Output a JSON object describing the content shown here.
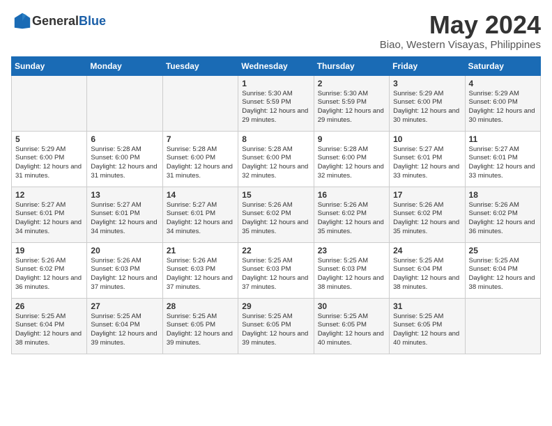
{
  "logo": {
    "general": "General",
    "blue": "Blue"
  },
  "title": "May 2024",
  "location": "Biao, Western Visayas, Philippines",
  "days_header": [
    "Sunday",
    "Monday",
    "Tuesday",
    "Wednesday",
    "Thursday",
    "Friday",
    "Saturday"
  ],
  "weeks": [
    [
      {
        "day": "",
        "info": ""
      },
      {
        "day": "",
        "info": ""
      },
      {
        "day": "",
        "info": ""
      },
      {
        "day": "1",
        "info": "Sunrise: 5:30 AM\nSunset: 5:59 PM\nDaylight: 12 hours\nand 29 minutes."
      },
      {
        "day": "2",
        "info": "Sunrise: 5:30 AM\nSunset: 5:59 PM\nDaylight: 12 hours\nand 29 minutes."
      },
      {
        "day": "3",
        "info": "Sunrise: 5:29 AM\nSunset: 6:00 PM\nDaylight: 12 hours\nand 30 minutes."
      },
      {
        "day": "4",
        "info": "Sunrise: 5:29 AM\nSunset: 6:00 PM\nDaylight: 12 hours\nand 30 minutes."
      }
    ],
    [
      {
        "day": "5",
        "info": "Sunrise: 5:29 AM\nSunset: 6:00 PM\nDaylight: 12 hours\nand 31 minutes."
      },
      {
        "day": "6",
        "info": "Sunrise: 5:28 AM\nSunset: 6:00 PM\nDaylight: 12 hours\nand 31 minutes."
      },
      {
        "day": "7",
        "info": "Sunrise: 5:28 AM\nSunset: 6:00 PM\nDaylight: 12 hours\nand 31 minutes."
      },
      {
        "day": "8",
        "info": "Sunrise: 5:28 AM\nSunset: 6:00 PM\nDaylight: 12 hours\nand 32 minutes."
      },
      {
        "day": "9",
        "info": "Sunrise: 5:28 AM\nSunset: 6:00 PM\nDaylight: 12 hours\nand 32 minutes."
      },
      {
        "day": "10",
        "info": "Sunrise: 5:27 AM\nSunset: 6:01 PM\nDaylight: 12 hours\nand 33 minutes."
      },
      {
        "day": "11",
        "info": "Sunrise: 5:27 AM\nSunset: 6:01 PM\nDaylight: 12 hours\nand 33 minutes."
      }
    ],
    [
      {
        "day": "12",
        "info": "Sunrise: 5:27 AM\nSunset: 6:01 PM\nDaylight: 12 hours\nand 34 minutes."
      },
      {
        "day": "13",
        "info": "Sunrise: 5:27 AM\nSunset: 6:01 PM\nDaylight: 12 hours\nand 34 minutes."
      },
      {
        "day": "14",
        "info": "Sunrise: 5:27 AM\nSunset: 6:01 PM\nDaylight: 12 hours\nand 34 minutes."
      },
      {
        "day": "15",
        "info": "Sunrise: 5:26 AM\nSunset: 6:02 PM\nDaylight: 12 hours\nand 35 minutes."
      },
      {
        "day": "16",
        "info": "Sunrise: 5:26 AM\nSunset: 6:02 PM\nDaylight: 12 hours\nand 35 minutes."
      },
      {
        "day": "17",
        "info": "Sunrise: 5:26 AM\nSunset: 6:02 PM\nDaylight: 12 hours\nand 35 minutes."
      },
      {
        "day": "18",
        "info": "Sunrise: 5:26 AM\nSunset: 6:02 PM\nDaylight: 12 hours\nand 36 minutes."
      }
    ],
    [
      {
        "day": "19",
        "info": "Sunrise: 5:26 AM\nSunset: 6:02 PM\nDaylight: 12 hours\nand 36 minutes."
      },
      {
        "day": "20",
        "info": "Sunrise: 5:26 AM\nSunset: 6:03 PM\nDaylight: 12 hours\nand 37 minutes."
      },
      {
        "day": "21",
        "info": "Sunrise: 5:26 AM\nSunset: 6:03 PM\nDaylight: 12 hours\nand 37 minutes."
      },
      {
        "day": "22",
        "info": "Sunrise: 5:25 AM\nSunset: 6:03 PM\nDaylight: 12 hours\nand 37 minutes."
      },
      {
        "day": "23",
        "info": "Sunrise: 5:25 AM\nSunset: 6:03 PM\nDaylight: 12 hours\nand 38 minutes."
      },
      {
        "day": "24",
        "info": "Sunrise: 5:25 AM\nSunset: 6:04 PM\nDaylight: 12 hours\nand 38 minutes."
      },
      {
        "day": "25",
        "info": "Sunrise: 5:25 AM\nSunset: 6:04 PM\nDaylight: 12 hours\nand 38 minutes."
      }
    ],
    [
      {
        "day": "26",
        "info": "Sunrise: 5:25 AM\nSunset: 6:04 PM\nDaylight: 12 hours\nand 38 minutes."
      },
      {
        "day": "27",
        "info": "Sunrise: 5:25 AM\nSunset: 6:04 PM\nDaylight: 12 hours\nand 39 minutes."
      },
      {
        "day": "28",
        "info": "Sunrise: 5:25 AM\nSunset: 6:05 PM\nDaylight: 12 hours\nand 39 minutes."
      },
      {
        "day": "29",
        "info": "Sunrise: 5:25 AM\nSunset: 6:05 PM\nDaylight: 12 hours\nand 39 minutes."
      },
      {
        "day": "30",
        "info": "Sunrise: 5:25 AM\nSunset: 6:05 PM\nDaylight: 12 hours\nand 40 minutes."
      },
      {
        "day": "31",
        "info": "Sunrise: 5:25 AM\nSunset: 6:05 PM\nDaylight: 12 hours\nand 40 minutes."
      },
      {
        "day": "",
        "info": ""
      }
    ]
  ]
}
